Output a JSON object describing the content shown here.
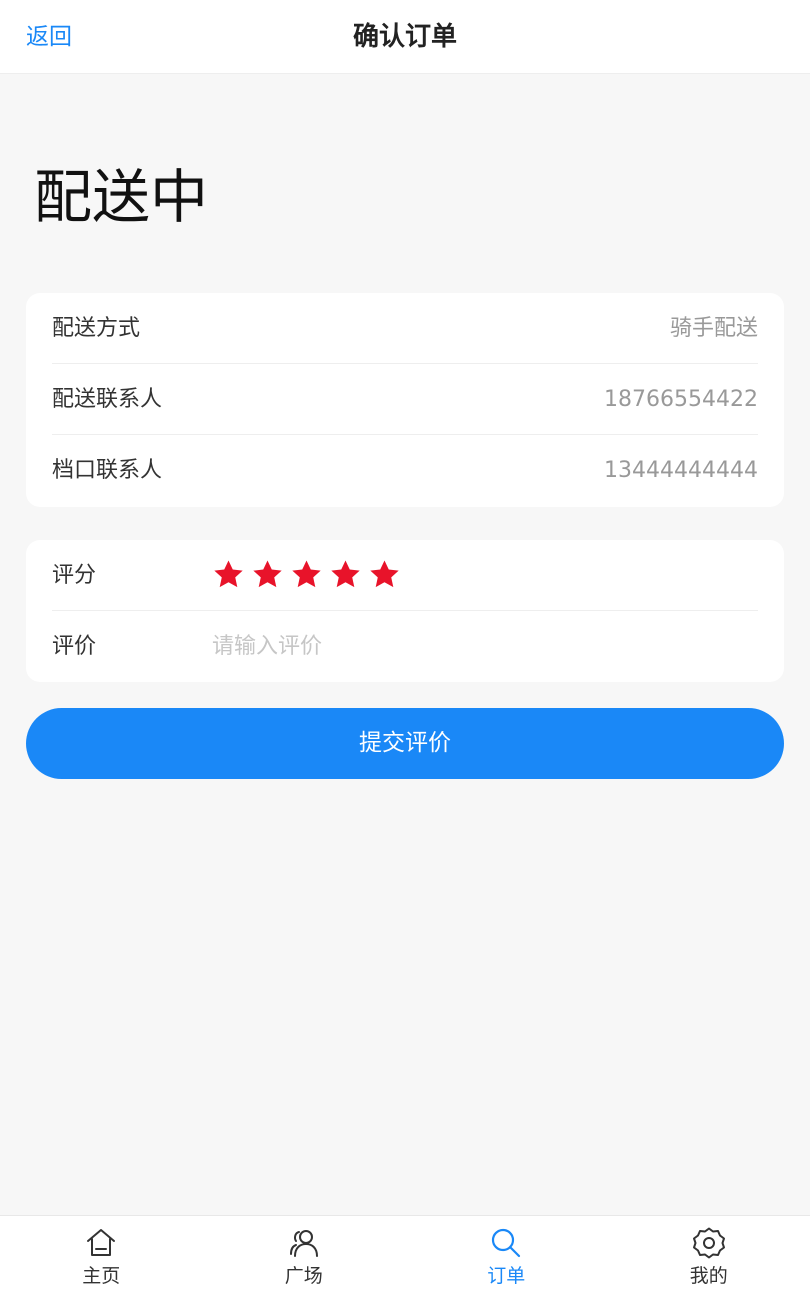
{
  "header": {
    "back_label": "返回",
    "title": "确认订单"
  },
  "status": "配送中",
  "delivery_info": {
    "rows": [
      {
        "label": "配送方式",
        "value": "骑手配送"
      },
      {
        "label": "配送联系人",
        "value": "18766554422"
      },
      {
        "label": "档口联系人",
        "value": "13444444444"
      }
    ]
  },
  "review": {
    "rating_label": "评分",
    "rating": 5,
    "rating_max": 5,
    "star_color": "#e8132a",
    "comment_label": "评价",
    "comment_placeholder": "请输入评价",
    "comment_value": ""
  },
  "submit_label": "提交评价",
  "tabbar": {
    "active_color": "#1a88f7",
    "tabs": [
      {
        "label": "主页",
        "icon": "home-icon"
      },
      {
        "label": "广场",
        "icon": "users-icon"
      },
      {
        "label": "订单",
        "icon": "search-icon",
        "active": true
      },
      {
        "label": "我的",
        "icon": "settings-icon"
      }
    ]
  }
}
